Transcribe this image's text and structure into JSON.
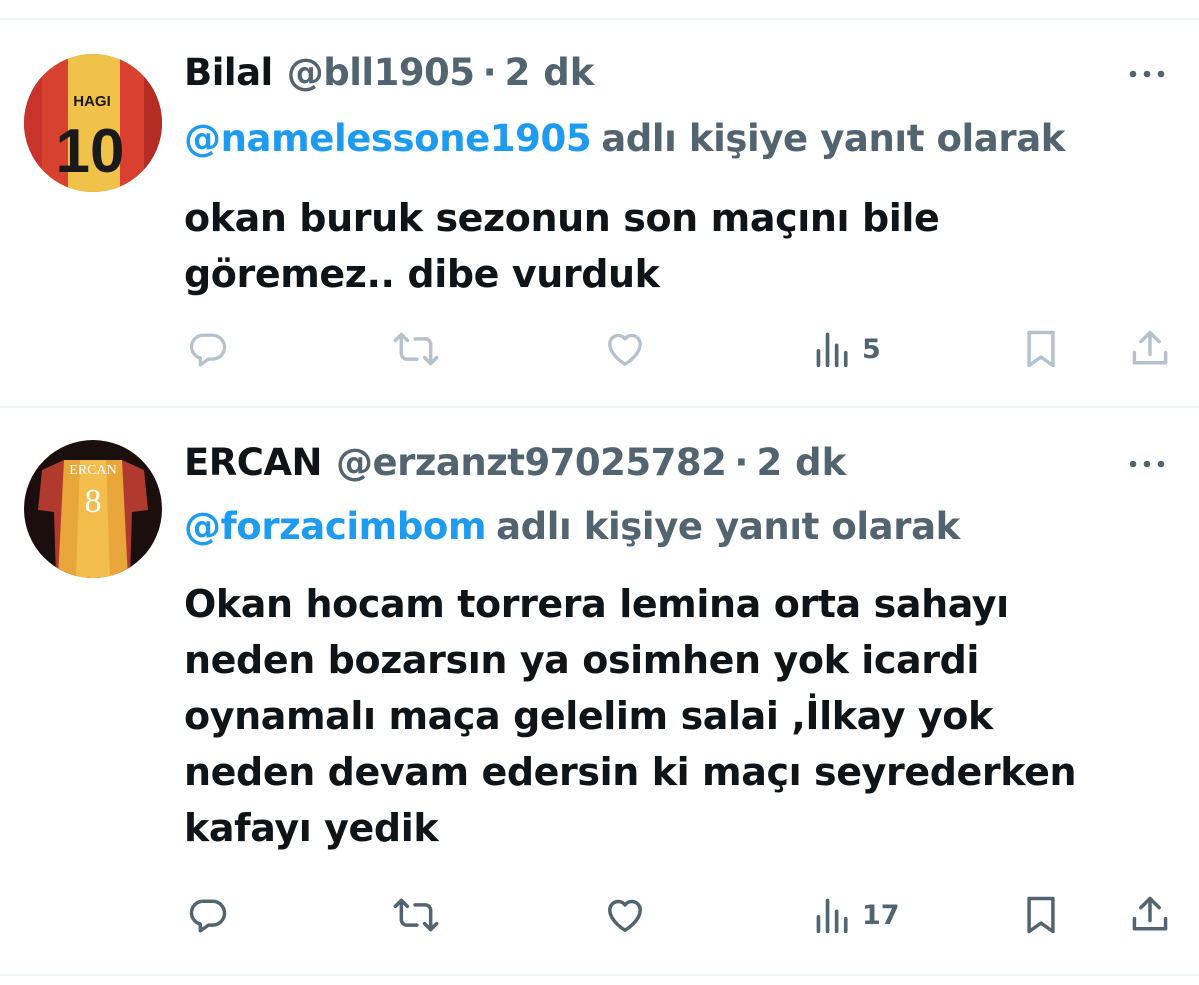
{
  "tweets": [
    {
      "display_name": "Bilal",
      "handle": "@bll1905",
      "dot": "·",
      "time": "2 dk",
      "avatar": {
        "icon": "hagi-10-jersey-avatar",
        "jersey_name": "HAGI",
        "jersey_number": "10"
      },
      "reply_mention": "@namelessone1905",
      "reply_suffix": "adlı kişiye yanıt olarak",
      "text_lines": [
        "okan buruk sezonun son maçını bile",
        "göremez.. dibe vurduk"
      ],
      "views": "5",
      "icons_color": "#b6c2cb"
    },
    {
      "display_name": "ERCAN",
      "handle": "@erzanzt97025782",
      "dot": "·",
      "time": "2 dk",
      "avatar": {
        "icon": "ercan-8-jersey-avatar",
        "jersey_name": "ERCAN",
        "jersey_number": "8"
      },
      "reply_mention": "@forzacimbom",
      "reply_suffix": "adlı kişiye yanıt olarak",
      "text_lines": [
        "Okan hocam torrera lemina orta sahayı",
        "neden bozarsın ya osimhen yok icardi",
        "oynamalı maça gelelim salai ,İlkay yok",
        "neden devam edersin ki maçı seyrederken",
        "kafayı yedik"
      ],
      "views": "17",
      "icons_color": "#536471"
    }
  ],
  "action_icons": [
    "reply-icon",
    "retweet-icon",
    "like-icon",
    "views-icon",
    "bookmark-icon",
    "share-icon"
  ],
  "colors": {
    "text": "#0f1419",
    "secondary": "#536471",
    "accent": "#1d9bf0",
    "divider": "#eff3f4"
  }
}
